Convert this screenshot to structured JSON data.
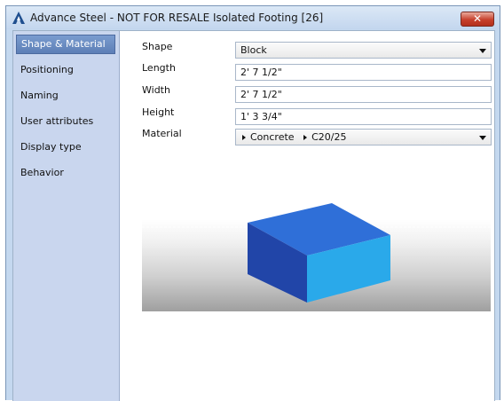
{
  "window": {
    "title": "Advance Steel - NOT FOR RESALE  Isolated Footing [26]",
    "close_label": "✕"
  },
  "sidebar": {
    "items": [
      {
        "label": "Shape & Material",
        "selected": true
      },
      {
        "label": "Positioning",
        "selected": false
      },
      {
        "label": "Naming",
        "selected": false
      },
      {
        "label": "User attributes",
        "selected": false
      },
      {
        "label": "Display type",
        "selected": false
      },
      {
        "label": "Behavior",
        "selected": false
      }
    ]
  },
  "form": {
    "shape": {
      "label": "Shape",
      "value": "Block"
    },
    "length": {
      "label": "Length",
      "value": "2' 7 1/2\""
    },
    "width": {
      "label": "Width",
      "value": "2' 7 1/2\""
    },
    "height": {
      "label": "Height",
      "value": "1' 3 3/4\""
    },
    "material": {
      "label": "Material",
      "path": [
        "Concrete",
        "C20/25"
      ]
    }
  },
  "colors": {
    "accent": "#5d7fb6",
    "box_top": "#2f6fd8",
    "box_left": "#2145a8",
    "box_right": "#2aa9ea"
  }
}
